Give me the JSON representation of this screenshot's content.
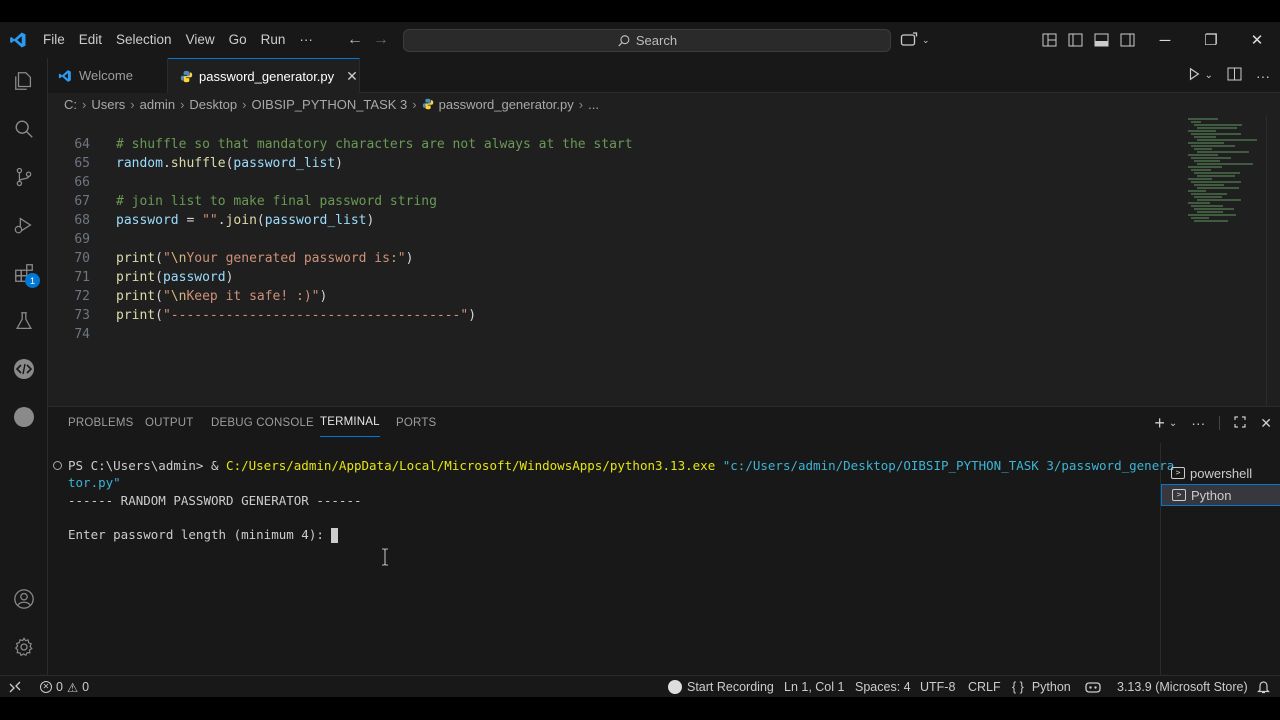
{
  "menu": [
    "File",
    "Edit",
    "Selection",
    "View",
    "Go",
    "Run",
    "···"
  ],
  "search": {
    "placeholder": "Search"
  },
  "tabs": {
    "welcome": "Welcome",
    "active": "password_generator.py"
  },
  "breadcrumb": [
    "C:",
    "Users",
    "admin",
    "Desktop",
    "OIBSIP_PYTHON_TASK 3",
    "password_generator.py",
    "..."
  ],
  "editor": {
    "lines": [
      {
        "n": "64",
        "segments": [
          {
            "t": "# shuffle so that mandatory characters are not always at the start",
            "c": "c-comment"
          }
        ]
      },
      {
        "n": "65",
        "segments": [
          {
            "t": "random",
            "c": "c-var"
          },
          {
            "t": ".",
            "c": "c-punc"
          },
          {
            "t": "shuffle",
            "c": "c-fn"
          },
          {
            "t": "(",
            "c": "c-punc"
          },
          {
            "t": "password_list",
            "c": "c-var"
          },
          {
            "t": ")",
            "c": "c-punc"
          }
        ]
      },
      {
        "n": "66",
        "segments": []
      },
      {
        "n": "67",
        "segments": [
          {
            "t": "# join list to make final password string",
            "c": "c-comment"
          }
        ]
      },
      {
        "n": "68",
        "segments": [
          {
            "t": "password",
            "c": "c-var"
          },
          {
            "t": " = ",
            "c": "c-punc"
          },
          {
            "t": "\"\"",
            "c": "c-str"
          },
          {
            "t": ".",
            "c": "c-punc"
          },
          {
            "t": "join",
            "c": "c-fn"
          },
          {
            "t": "(",
            "c": "c-punc"
          },
          {
            "t": "password_list",
            "c": "c-var"
          },
          {
            "t": ")",
            "c": "c-punc"
          }
        ]
      },
      {
        "n": "69",
        "segments": []
      },
      {
        "n": "70",
        "segments": [
          {
            "t": "print",
            "c": "c-fn"
          },
          {
            "t": "(",
            "c": "c-punc"
          },
          {
            "t": "\"",
            "c": "c-str"
          },
          {
            "t": "\\n",
            "c": "c-esc"
          },
          {
            "t": "Your generated password is:\"",
            "c": "c-str"
          },
          {
            "t": ")",
            "c": "c-punc"
          }
        ]
      },
      {
        "n": "71",
        "segments": [
          {
            "t": "print",
            "c": "c-fn"
          },
          {
            "t": "(",
            "c": "c-punc"
          },
          {
            "t": "password",
            "c": "c-var"
          },
          {
            "t": ")",
            "c": "c-punc"
          }
        ]
      },
      {
        "n": "72",
        "segments": [
          {
            "t": "print",
            "c": "c-fn"
          },
          {
            "t": "(",
            "c": "c-punc"
          },
          {
            "t": "\"",
            "c": "c-str"
          },
          {
            "t": "\\n",
            "c": "c-esc"
          },
          {
            "t": "Keep it safe! :)\"",
            "c": "c-str"
          },
          {
            "t": ")",
            "c": "c-punc"
          }
        ]
      },
      {
        "n": "73",
        "segments": [
          {
            "t": "print",
            "c": "c-fn"
          },
          {
            "t": "(",
            "c": "c-punc"
          },
          {
            "t": "\"-------------------------------------\"",
            "c": "c-str"
          },
          {
            "t": ")",
            "c": "c-punc"
          }
        ]
      },
      {
        "n": "74",
        "segments": []
      }
    ]
  },
  "panel": {
    "tabs": [
      "PROBLEMS",
      "OUTPUT",
      "DEBUG CONSOLE",
      "TERMINAL",
      "PORTS"
    ],
    "terminal": {
      "prompt": "PS C:\\Users\\admin> & ",
      "exe": "C:/Users/admin/AppData/Local/Microsoft/WindowsApps/python3.13.exe",
      "arg_line1": " \"c:/Users/admin/Desktop/OIBSIP_PYTHON_TASK 3/password_genera",
      "arg_line2": "tor.py\"",
      "out1": "------ RANDOM PASSWORD GENERATOR ------",
      "out2": "Enter password length (minimum 4): "
    },
    "terminals": [
      "powershell",
      "Python"
    ]
  },
  "status": {
    "errors": "0",
    "warnings": "0",
    "recording": "Start Recording",
    "position": "Ln 1, Col 1",
    "spaces": "Spaces: 4",
    "encoding": "UTF-8",
    "eol": "CRLF",
    "language": "Python",
    "interpreter": "3.13.9 (Microsoft Store)"
  },
  "activity_badge": "1",
  "colors": {
    "accent": "#0078d4",
    "comment": "#6a9955",
    "string": "#ce9178"
  }
}
